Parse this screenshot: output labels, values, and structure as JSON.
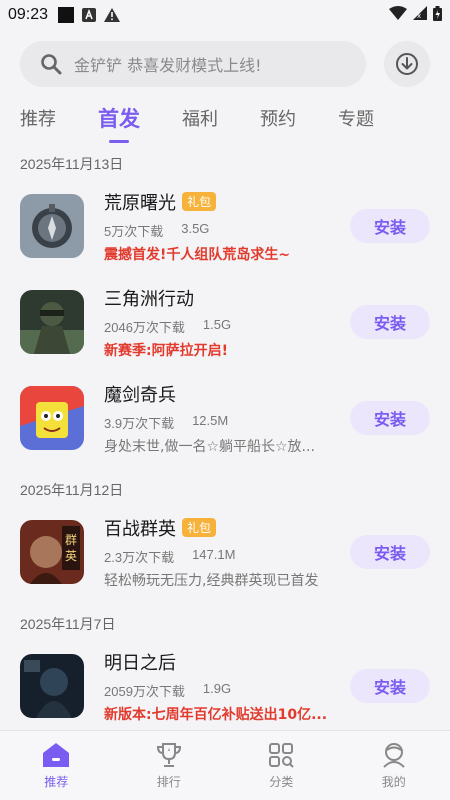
{
  "status": {
    "time": "09:23"
  },
  "search": {
    "placeholder": "金铲铲 恭喜发财模式上线!"
  },
  "tabs": [
    {
      "label": "推荐",
      "active": false
    },
    {
      "label": "首发",
      "active": true
    },
    {
      "label": "福利",
      "active": false
    },
    {
      "label": "预约",
      "active": false
    },
    {
      "label": "专题",
      "active": false
    }
  ],
  "sections": [
    {
      "date": "2025年11月13日",
      "apps": [
        {
          "name": "荒原曙光",
          "badge": "礼包",
          "downloads": "5万次下载",
          "size": "3.5G",
          "desc": "震撼首发!千人组队荒岛求生~",
          "desc_style": "hot",
          "install": "安装"
        },
        {
          "name": "三角洲行动",
          "badge": "",
          "downloads": "2046万次下载",
          "size": "1.5G",
          "desc": "新赛季:阿萨拉开启!",
          "desc_style": "hot",
          "install": "安装"
        },
        {
          "name": "魔剑奇兵",
          "badge": "",
          "downloads": "3.9万次下载",
          "size": "12.5M",
          "desc": "身处末世,做一名☆躺平船长☆放...",
          "desc_style": "normal",
          "install": "安装"
        }
      ]
    },
    {
      "date": "2025年11月12日",
      "apps": [
        {
          "name": "百战群英",
          "badge": "礼包",
          "downloads": "2.3万次下载",
          "size": "147.1M",
          "desc": "轻松畅玩无压力,经典群英现已首发",
          "desc_style": "normal",
          "install": "安装"
        }
      ]
    },
    {
      "date": "2025年11月7日",
      "apps": [
        {
          "name": "明日之后",
          "badge": "",
          "downloads": "2059万次下载",
          "size": "1.9G",
          "desc": "新版本:七周年百亿补贴送出10亿...",
          "desc_style": "hot",
          "install": "安装"
        }
      ]
    }
  ],
  "bottom_nav": [
    {
      "label": "推荐",
      "icon": "home-icon",
      "active": true
    },
    {
      "label": "排行",
      "icon": "trophy-icon",
      "active": false
    },
    {
      "label": "分类",
      "icon": "category-icon",
      "active": false
    },
    {
      "label": "我的",
      "icon": "profile-icon",
      "active": false
    }
  ],
  "colors": {
    "accent": "#7b5cf0",
    "hot_text": "#e23b2e",
    "gift_badge": "#f6b23b"
  }
}
